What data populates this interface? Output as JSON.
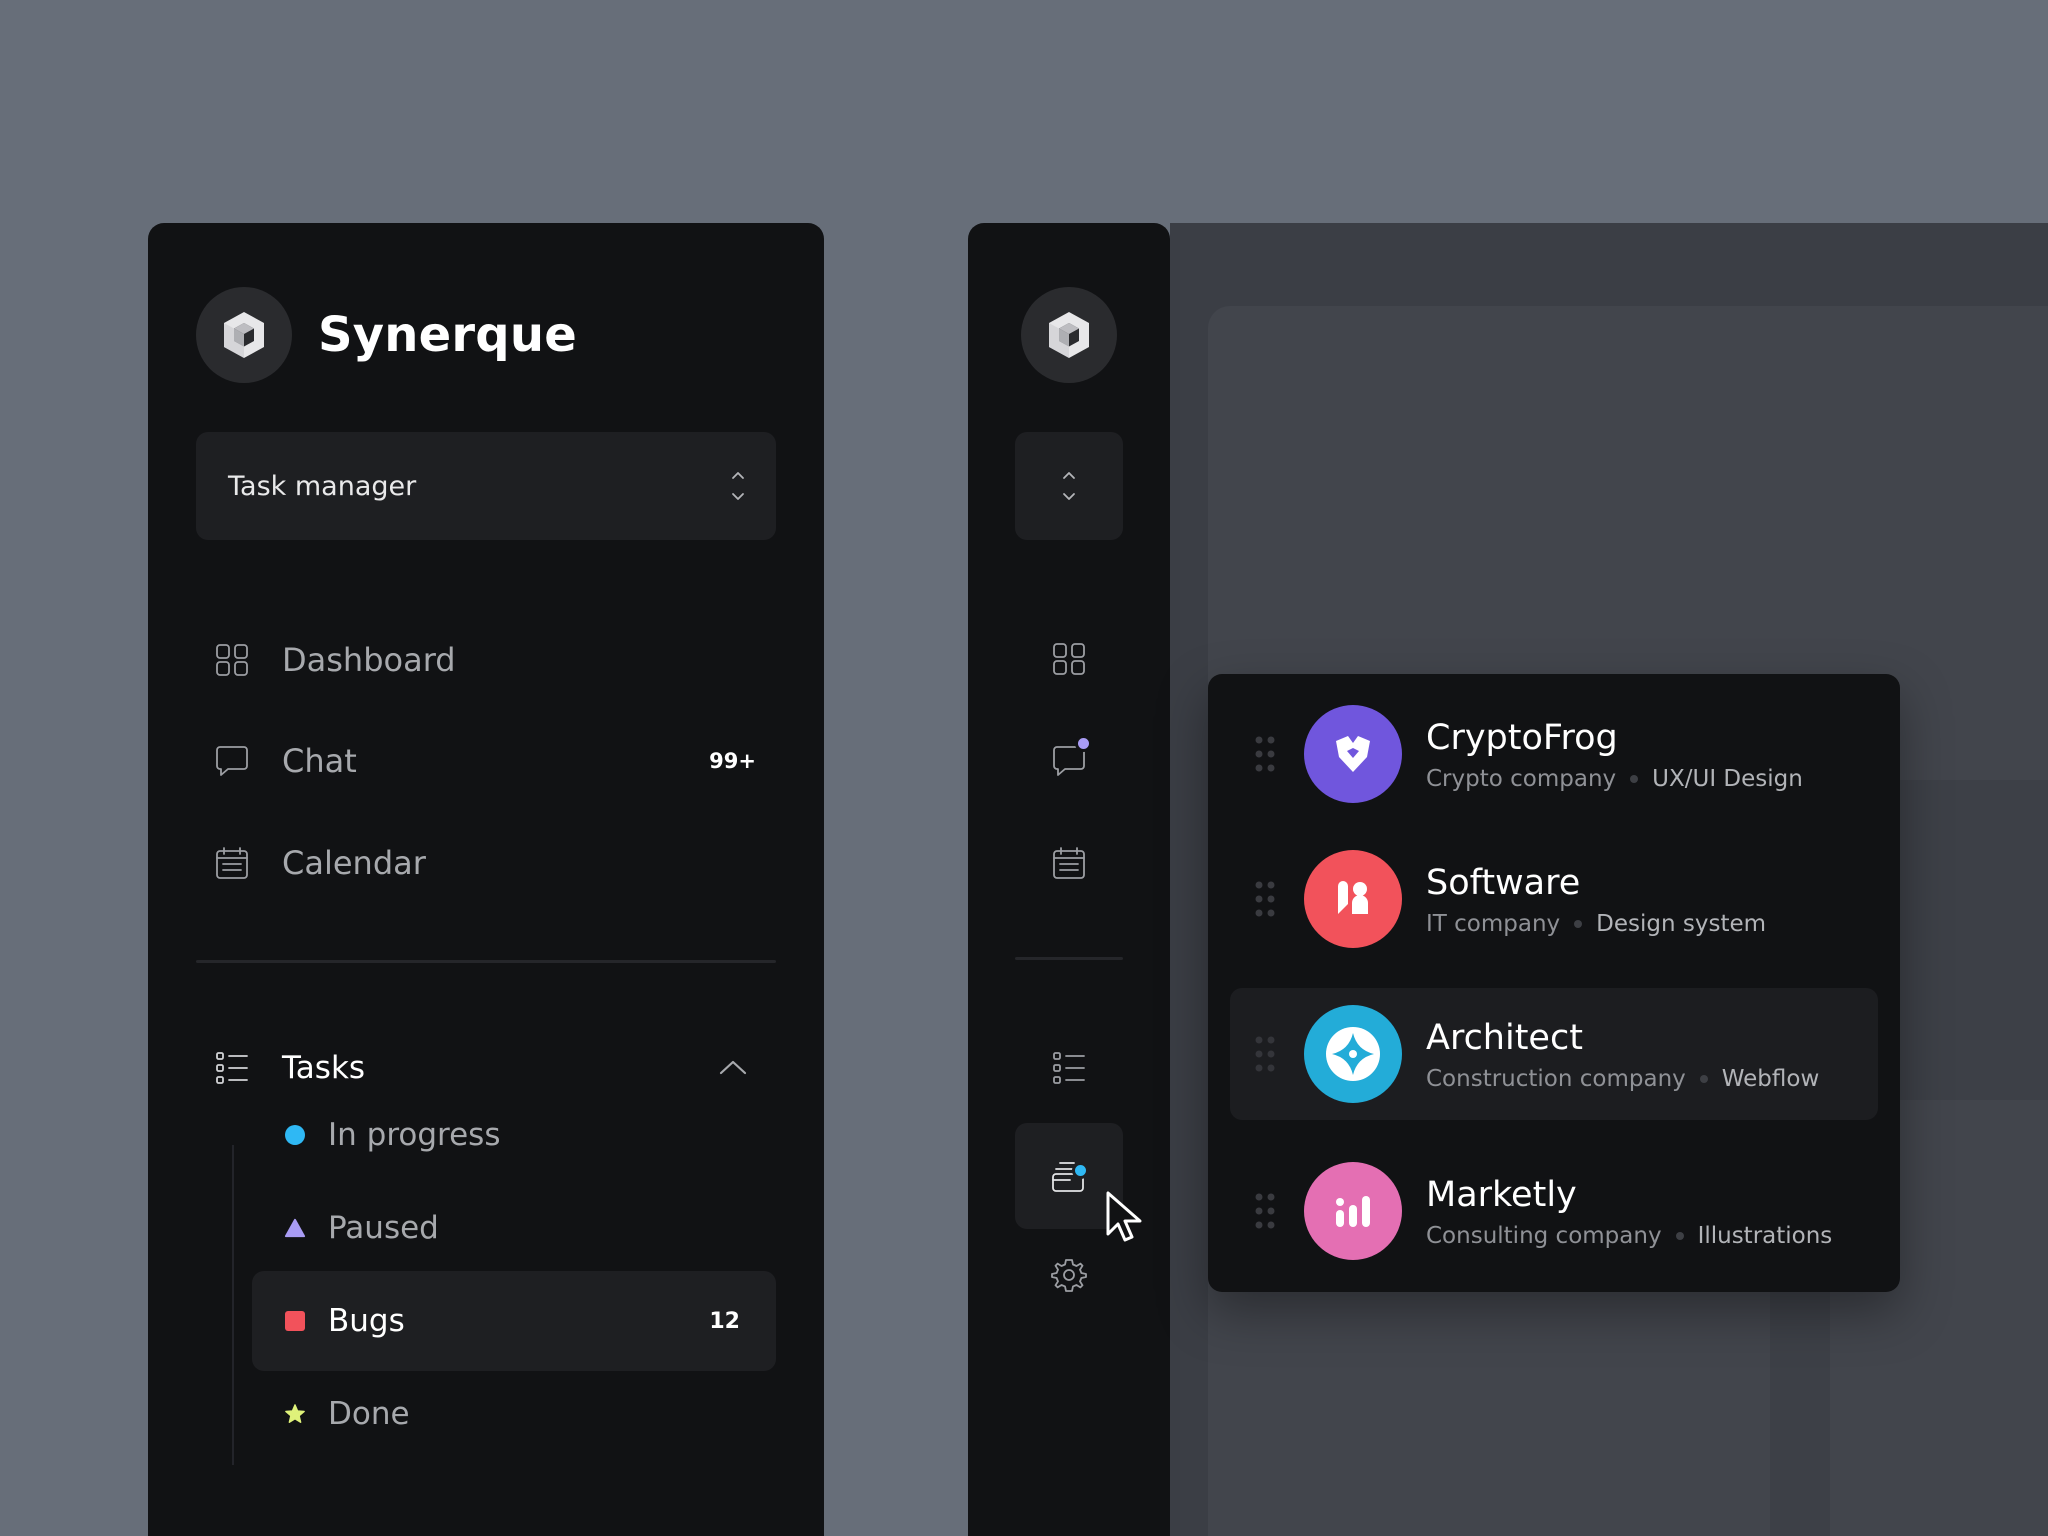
{
  "app": {
    "name": "Synerque",
    "logo_icon": "cube-logo-icon"
  },
  "workspace": {
    "selected": "Task manager",
    "icon": "chevron-up-down-icon"
  },
  "nav": [
    {
      "label": "Dashboard",
      "icon": "dashboard-grid-icon",
      "badge": ""
    },
    {
      "label": "Chat",
      "icon": "chat-bubble-icon",
      "badge": "99+"
    },
    {
      "label": "Calendar",
      "icon": "calendar-icon",
      "badge": ""
    }
  ],
  "tasks": {
    "label": "Tasks",
    "icon": "task-list-icon",
    "expanded": true,
    "items": [
      {
        "label": "In progress",
        "marker": "circle",
        "color": "#2fb8f4",
        "count": ""
      },
      {
        "label": "Paused",
        "marker": "triangle",
        "color": "#a99cf4",
        "count": ""
      },
      {
        "label": "Bugs",
        "marker": "square",
        "color": "#f2525b",
        "count": "12",
        "active": true
      },
      {
        "label": "Done",
        "marker": "star",
        "color": "#dff27a",
        "count": ""
      }
    ]
  },
  "rail": {
    "icons": [
      "cube-logo-icon",
      "chevron-up-down-icon",
      "dashboard-grid-icon",
      "chat-bubble-icon",
      "calendar-icon",
      "task-list-icon",
      "projects-stack-icon",
      "settings-gear-icon"
    ],
    "chat_dot_color": "#a99cf4",
    "projects_dot_color": "#2fb8f4"
  },
  "projects": [
    {
      "name": "CryptoFrog",
      "type": "Crypto company",
      "tag": "UX/UI Design",
      "color": "#7056dd",
      "icon": "frog-shield-icon"
    },
    {
      "name": "Software",
      "type": "IT company",
      "tag": "Design system",
      "color": "#f2525b",
      "icon": "software-blocks-icon"
    },
    {
      "name": "Architect",
      "type": "Construction company",
      "tag": "Webflow",
      "color": "#23acd8",
      "icon": "architect-star-icon",
      "active": true
    },
    {
      "name": "Marketly",
      "type": "Consulting company",
      "tag": "Illustrations",
      "color": "#e46fb3",
      "icon": "bar-chart-icon"
    }
  ],
  "colors": {
    "panel": "#111214",
    "surface": "#1e1f22",
    "background": "#676e79"
  }
}
